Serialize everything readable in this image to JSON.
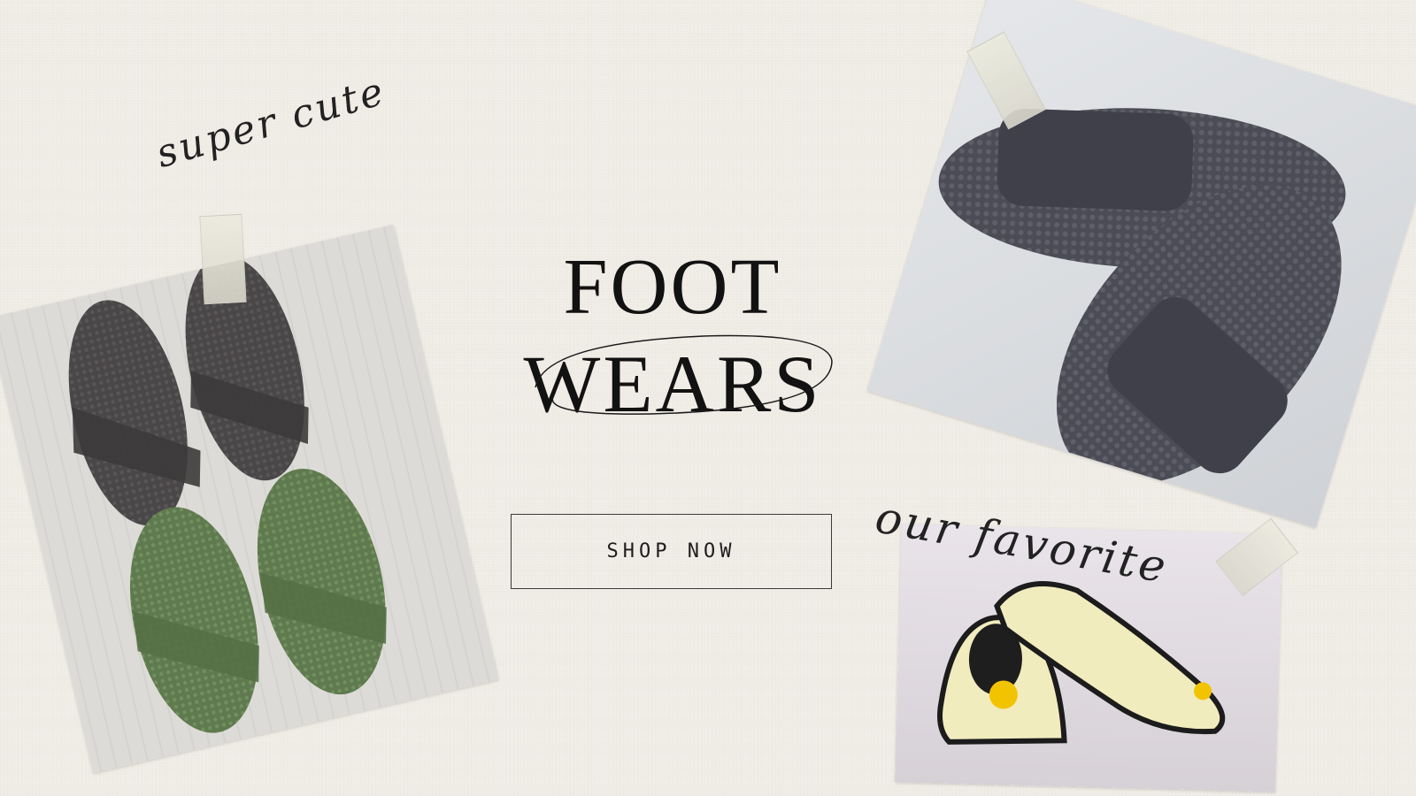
{
  "tagline_top": "super cute",
  "tagline_bottom": "our favorite",
  "hero": {
    "line1": "FOOT",
    "line2": "WEARS"
  },
  "cta": {
    "label": "SHOP NOW"
  },
  "photos": [
    {
      "subject": "grey and green crochet cross-strap slippers"
    },
    {
      "subject": "charcoal knitted open-toe slippers"
    },
    {
      "subject": "cream crochet flats with yellow flower"
    }
  ],
  "colors": {
    "background": "#f1ede7",
    "text": "#121212"
  }
}
